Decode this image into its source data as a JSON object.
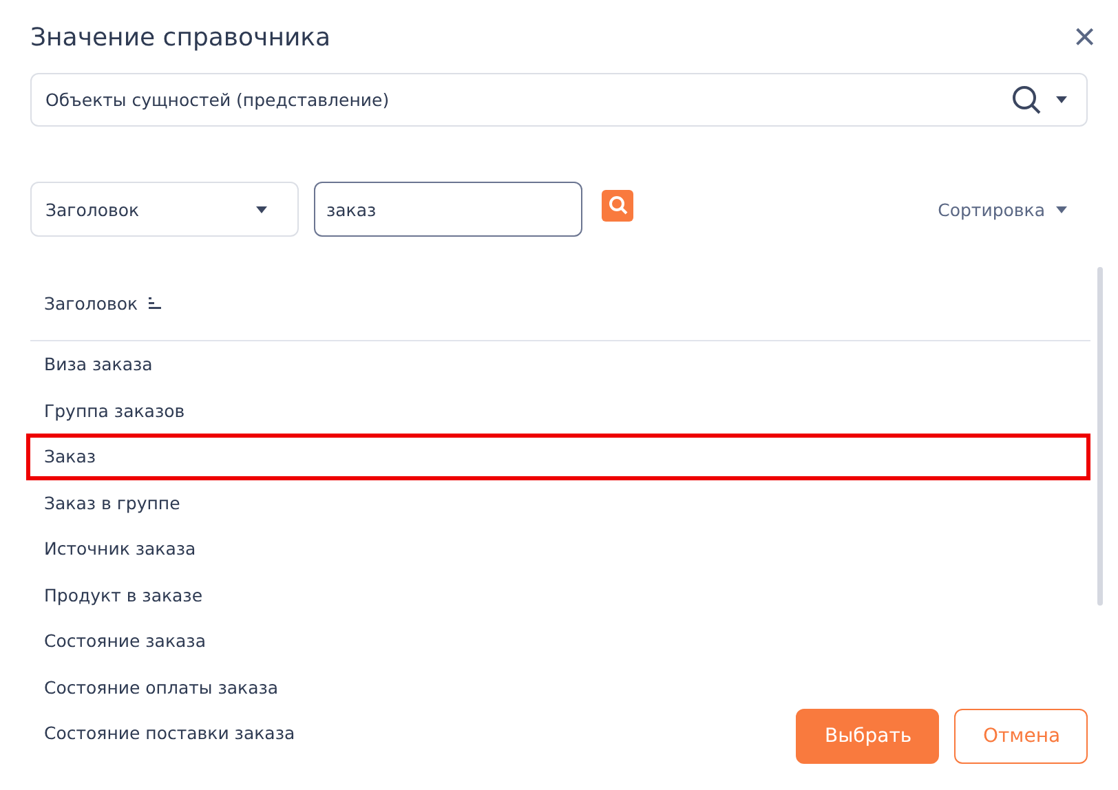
{
  "dialog": {
    "title": "Значение справочника",
    "close": "×"
  },
  "source": {
    "value": "Объекты сущностей (представление)"
  },
  "filter": {
    "field": "Заголовок",
    "query": "заказ"
  },
  "sort": {
    "label": "Сортировка"
  },
  "table": {
    "column": "Заголовок",
    "rows": [
      {
        "title": "Виза заказа",
        "selected": false
      },
      {
        "title": "Группа заказов",
        "selected": false
      },
      {
        "title": "Заказ",
        "selected": true
      },
      {
        "title": "Заказ в группе",
        "selected": false
      },
      {
        "title": "Источник заказа",
        "selected": false
      },
      {
        "title": "Продукт в заказе",
        "selected": false
      },
      {
        "title": "Состояние заказа",
        "selected": false
      },
      {
        "title": "Состояние оплаты заказа",
        "selected": false
      },
      {
        "title": "Состояние поставки заказа",
        "selected": false
      }
    ]
  },
  "buttons": [
    {
      "label": "Выбрать",
      "kind": "primary"
    },
    {
      "label": "Отмена",
      "kind": "secondary"
    }
  ]
}
